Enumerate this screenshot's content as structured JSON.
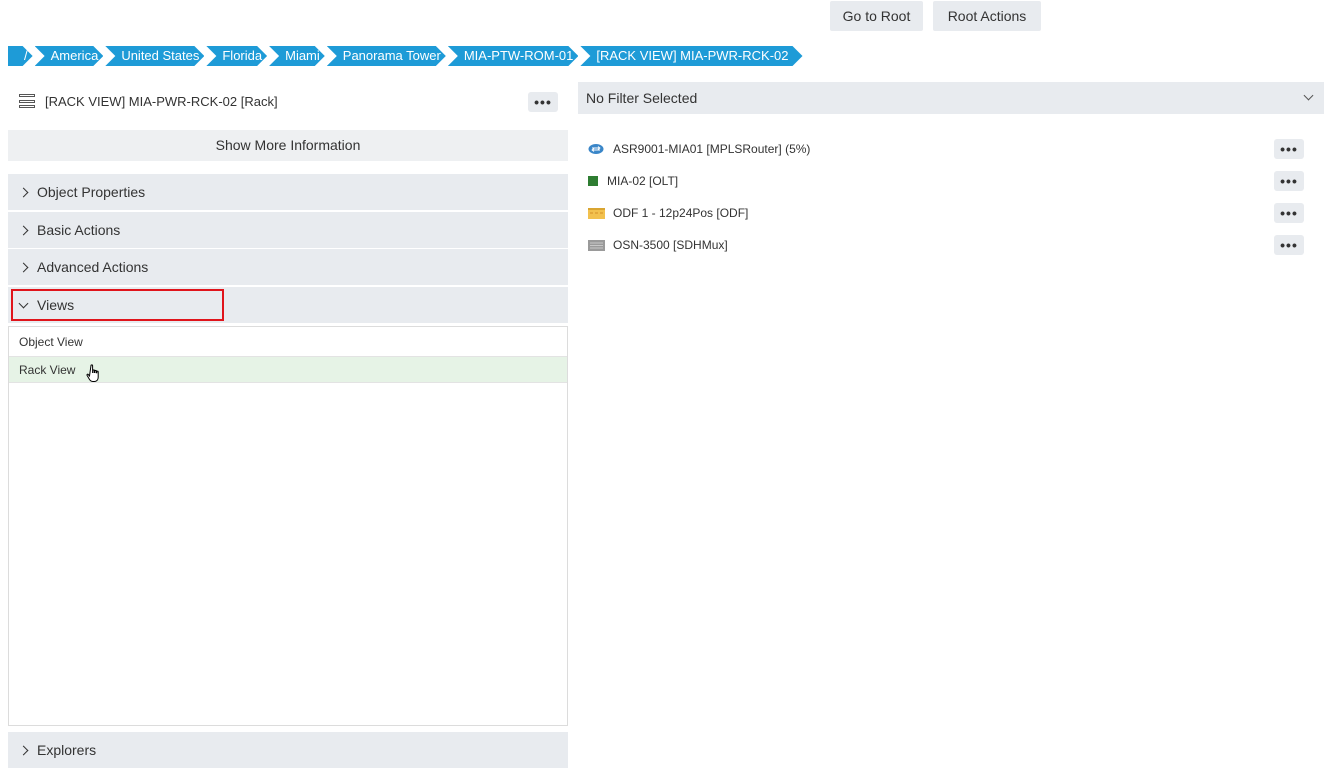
{
  "top_buttons": {
    "go_root": "Go to Root",
    "root_actions": "Root Actions"
  },
  "breadcrumb": [
    "/",
    "America",
    "United States",
    "Florida",
    "Miami",
    "Panorama Tower",
    "MIA-PTW-ROM-01",
    "[RACK VIEW] MIA-PWR-RCK-02"
  ],
  "object": {
    "title": "[RACK VIEW] MIA-PWR-RCK-02 [Rack]",
    "more_label": "•••"
  },
  "show_more": "Show More Information",
  "sections": {
    "object_properties": "Object Properties",
    "basic_actions": "Basic Actions",
    "advanced_actions": "Advanced Actions",
    "views": "Views",
    "explorers": "Explorers"
  },
  "views": [
    "Object View",
    "Rack View"
  ],
  "filter": {
    "selected": "No Filter Selected"
  },
  "rack_items": [
    {
      "label": "ASR9001-MIA01 [MPLSRouter] (5%)",
      "icon": "router-icon",
      "color": "#3a86c8"
    },
    {
      "label": "MIA-02 [OLT]",
      "icon": "olt-icon",
      "color": "#2e7d32"
    },
    {
      "label": "ODF 1 - 12p24Pos [ODF]",
      "icon": "odf-icon",
      "color": "#f2c14e"
    },
    {
      "label": "OSN-3500 [SDHMux]",
      "icon": "sdhmux-icon",
      "color": "#9a9a9a"
    }
  ],
  "colors": {
    "breadcrumb": "#1e9bd7",
    "highlight": "#e0141b",
    "selected_row": "#e6f3e6"
  }
}
